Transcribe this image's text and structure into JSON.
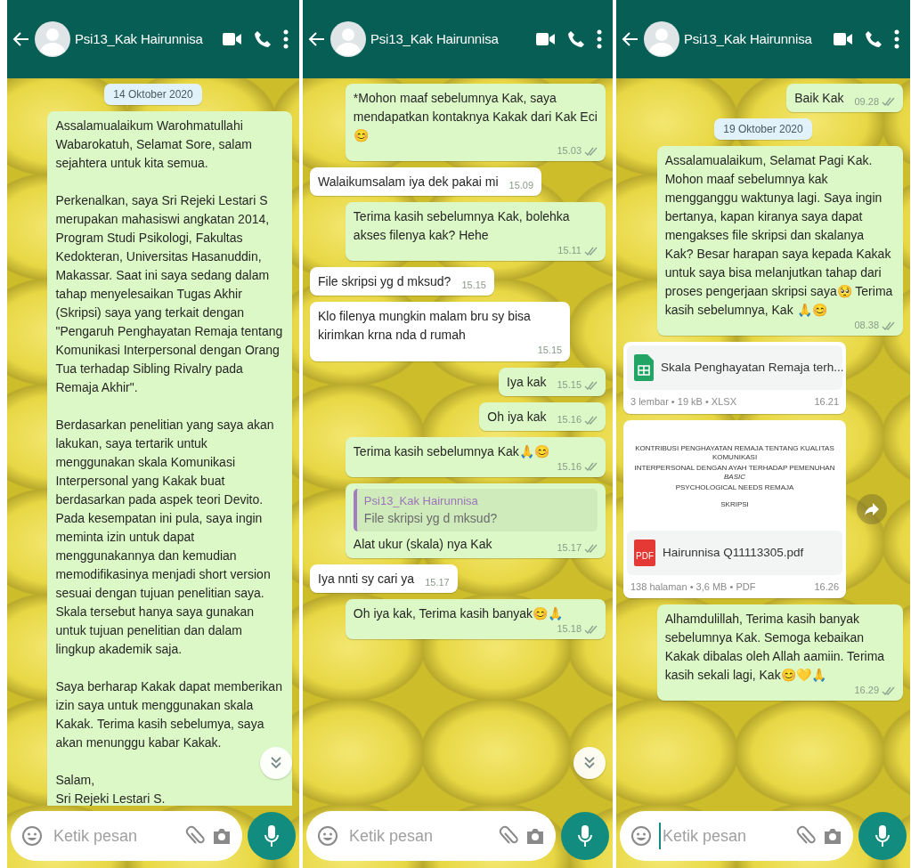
{
  "panels": [
    {
      "header": {
        "contact": "Psi13_Kak Hairunnisa"
      },
      "scroll_button": true,
      "messages": [
        {
          "kind": "date",
          "text": "14 Oktober 2020"
        },
        {
          "kind": "out",
          "paragraphs": [
            "Assalamualaikum Warohmatullahi Wabarokatuh, Selamat Sore, salam sejahtera untuk kita semua.",
            "Perkenalkan, saya Sri Rejeki Lestari S merupakan mahasiswi angkatan 2014, Program Studi Psikologi, Fakultas Kedokteran, Universitas Hasanuddin, Makassar. Saat ini saya sedang dalam tahap menyelesaikan Tugas Akhir (Skripsi) saya yang terkait dengan \"Pengaruh Penghayatan Remaja tentang Komunikasi Interpersonal dengan Orang Tua terhadap Sibling Rivalry pada Remaja Akhir\".",
            "Berdasarkan penelitian yang saya akan lakukan, saya tertarik untuk menggunakan skala Komunikasi Interpersonal yang Kakak buat berdasarkan pada aspek teori Devito. Pada kesempatan ini pula, saya ingin meminta izin untuk dapat menggunakannya dan kemudian memodifikasinya menjadi short version sesuai dengan tujuan penelitian saya. Skala tersebut hanya saya gunakan untuk tujuan penelitian dan dalam lingkup akademik saja.",
            "Saya berharap Kakak dapat memberikan izin saya untuk menggunakan skala Kakak. Terima kasih sebelumya, saya akan menunggu kabar Kakak.",
            "Salam,\nSri Rejeki Lestari S."
          ]
        }
      ],
      "composer": {
        "placeholder": "Ketik pesan",
        "focused": false
      }
    },
    {
      "header": {
        "contact": "Psi13_Kak Hairunnisa"
      },
      "scroll_button": true,
      "messages": [
        {
          "kind": "out",
          "paragraphs": [
            "*Mohon maaf sebelumnya Kak, saya mendapatkan kontaknya Kakak dari Kak Eci😊"
          ],
          "time": "15.03"
        },
        {
          "kind": "in",
          "paragraphs": [
            "Walaikumsalam iya dek pakai mi"
          ],
          "time": "15.09"
        },
        {
          "kind": "out",
          "paragraphs": [
            "Terima kasih sebelumnya Kak, bolehka akses filenya kak? Hehe"
          ],
          "time": "15.11"
        },
        {
          "kind": "in",
          "paragraphs": [
            "File skripsi yg d mksud?"
          ],
          "time": "15.15"
        },
        {
          "kind": "in",
          "paragraphs": [
            "Klo filenya mungkin malam bru sy bisa kirimkan krna nda d rumah"
          ],
          "time": "15.15"
        },
        {
          "kind": "out",
          "paragraphs": [
            "Iya kak"
          ],
          "time": "15.15"
        },
        {
          "kind": "out",
          "paragraphs": [
            "Oh iya kak"
          ],
          "time": "15.16"
        },
        {
          "kind": "out",
          "paragraphs": [
            "Terima kasih sebelumnya Kak🙏😊"
          ],
          "time": "15.16"
        },
        {
          "kind": "reply",
          "quote": {
            "author": "Psi13_Kak Hairunnisa",
            "text": "File skripsi yg d mksud?"
          },
          "paragraphs": [
            "Alat ukur (skala) nya Kak"
          ],
          "time": "15.17"
        },
        {
          "kind": "in",
          "paragraphs": [
            "Iya nnti sy cari ya"
          ],
          "time": "15.17"
        },
        {
          "kind": "out",
          "paragraphs": [
            "Oh iya kak, Terima kasih banyak😊🙏"
          ],
          "time": "15.18"
        }
      ],
      "composer": {
        "placeholder": "Ketik pesan",
        "focused": false
      }
    },
    {
      "header": {
        "contact": "Psi13_Kak Hairunnisa"
      },
      "scroll_button": false,
      "messages": [
        {
          "kind": "out",
          "paragraphs": [
            "Baik Kak"
          ],
          "time": "09.28"
        },
        {
          "kind": "date",
          "text": "19 Oktober 2020"
        },
        {
          "kind": "out",
          "paragraphs": [
            "Assalamualaikum, Selamat Pagi Kak. Mohon maaf sebelumnya kak mengganggu waktunya lagi. Saya ingin bertanya, kapan kiranya saya dapat mengakses file skripsi dan skalanya Kak? Besar harapan saya kepada Kakak untuk saya bisa melanjutkan tahap dari proses pengerjaan skripsi saya🥺 Terima kasih sebelumnya, Kak 🙏😊"
          ],
          "time": "08.38"
        },
        {
          "kind": "file",
          "icon": {
            "kind": "spreadsheet"
          },
          "name": "Skala Penghayatan Remaja terh...",
          "meta": "3 lembar • 19 kB • XLSX",
          "time": "16.21",
          "forward": false
        },
        {
          "kind": "file",
          "icon": {
            "kind": "pdf",
            "label": "PDF"
          },
          "preview_lines": [
            "KONTRIBUSI PENGHAYATAN REMAJA TENTANG KUALITAS KOMUNIKASI",
            "INTERPERSONAL DENGAN AYAH TERHADAP PEMENUHAN *BASIC*",
            "PSYCHOLOGICAL NEEDS REMAJA",
            "SKRIPSI"
          ],
          "name": "Hairunnisa Q11113305.pdf",
          "meta": "138 halaman • 3,6 MB • PDF",
          "time": "16.26",
          "forward": true
        },
        {
          "kind": "out",
          "paragraphs": [
            "Alhamdulillah, Terima kasih banyak sebelumnya Kak. Semoga kebaikan Kakak dibalas oleh Allah aamiin. Terima kasih sekali lagi, Kak😊💛🙏"
          ],
          "time": "16.29"
        }
      ],
      "composer": {
        "placeholder": "Ketik pesan",
        "focused": true
      }
    }
  ]
}
